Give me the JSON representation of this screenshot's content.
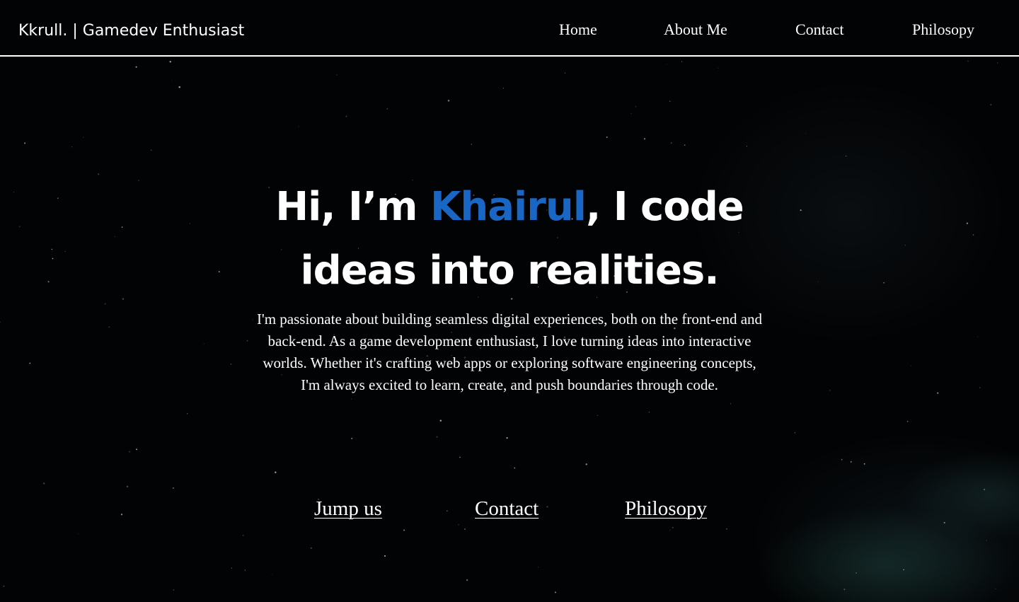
{
  "header": {
    "brand": "Kkrull. | Gamedev Enthusiast",
    "nav": [
      {
        "label": "Home"
      },
      {
        "label": "About Me"
      },
      {
        "label": "Contact"
      },
      {
        "label": "Philosopy"
      }
    ]
  },
  "hero": {
    "greeting": "Hi, I’m ",
    "name": "Khairul",
    "tagline_rest": ", I code ideas into realities.",
    "description": "I'm passionate about building seamless digital experiences, both on the front-end and back-end. As a game development enthusiast, I love turning ideas into interactive worlds. Whether it's crafting web apps or exploring software engineering concepts, I'm always excited to learn, create, and push boundaries through code."
  },
  "links": [
    {
      "label": "Jump us"
    },
    {
      "label": "Contact"
    },
    {
      "label": "Philosopy"
    }
  ],
  "colors": {
    "background": "#020304",
    "text": "#ffffff",
    "accent": "#1a66c4"
  }
}
